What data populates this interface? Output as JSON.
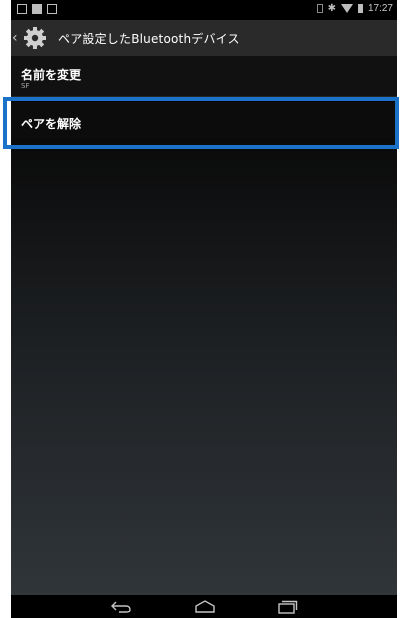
{
  "status_bar": {
    "time": "17:27",
    "icons_left": [
      "notification-icon",
      "screenshot-icon",
      "image-icon"
    ],
    "icons_right": [
      "vibrate-icon",
      "bluetooth-icon",
      "wifi-icon",
      "battery-icon"
    ]
  },
  "action_bar": {
    "title": "ペア設定したBluetoothデバイス",
    "icon": "settings-gear-icon"
  },
  "list": {
    "rename": {
      "title": "名前を変更",
      "subtitle": "SF"
    },
    "unpair": {
      "title": "ペアを解除"
    }
  },
  "highlight": {
    "color": "#1a73c9",
    "target": "unpair"
  },
  "navigation_bar": {
    "buttons": [
      "back-icon",
      "home-icon",
      "recents-icon"
    ]
  }
}
